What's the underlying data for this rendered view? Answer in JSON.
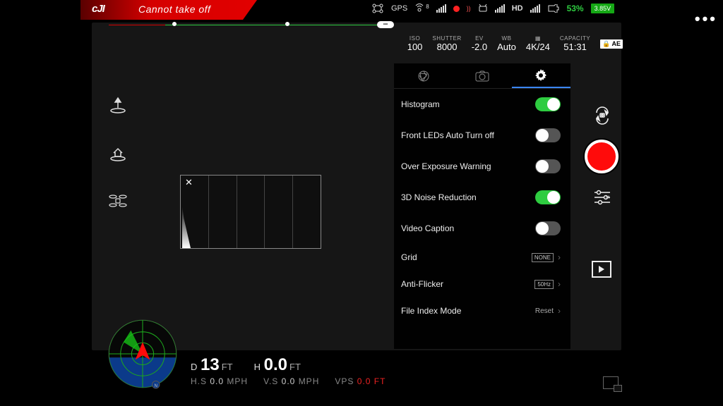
{
  "header": {
    "logo": "cJI",
    "status": "Cannot take off",
    "gps_label": "GPS",
    "sat_count": "8",
    "hd_label": "HD",
    "battery_pct": "53%",
    "battery_volt": "3.85V"
  },
  "camera": {
    "iso": {
      "label": "ISO",
      "value": "100"
    },
    "shutter": {
      "label": "SHUTTER",
      "value": "8000"
    },
    "ev": {
      "label": "EV",
      "value": "-2.0"
    },
    "wb": {
      "label": "WB",
      "value": "Auto"
    },
    "fmt": {
      "label": "",
      "value": "4K/24"
    },
    "capacity": {
      "label": "CAPACITY",
      "value": "51:31"
    },
    "ae": "AE"
  },
  "settings": {
    "items": [
      {
        "label": "Histogram",
        "on": true,
        "type": "toggle"
      },
      {
        "label": "Front LEDs Auto Turn off",
        "on": false,
        "type": "toggle"
      },
      {
        "label": "Over Exposure Warning",
        "on": false,
        "type": "toggle"
      },
      {
        "label": "3D Noise Reduction",
        "on": true,
        "type": "toggle"
      },
      {
        "label": "Video Caption",
        "on": false,
        "type": "toggle"
      },
      {
        "label": "Grid",
        "value": "NONE",
        "type": "select"
      },
      {
        "label": "Anti-Flicker",
        "value": "50Hz",
        "type": "select"
      },
      {
        "label": "File Index Mode",
        "value": "Reset",
        "type": "select"
      }
    ]
  },
  "telemetry": {
    "d_label": "D",
    "d_val": "13",
    "d_unit": "FT",
    "h_label": "H",
    "h_val": "0.0",
    "h_unit": "FT",
    "hs_label": "H.S",
    "hs_val": "0.0",
    "hs_unit": "MPH",
    "vs_label": "V.S",
    "vs_val": "0.0",
    "vs_unit": "MPH",
    "vps_label": "VPS",
    "vps_val": "0.0",
    "vps_unit": "FT"
  }
}
